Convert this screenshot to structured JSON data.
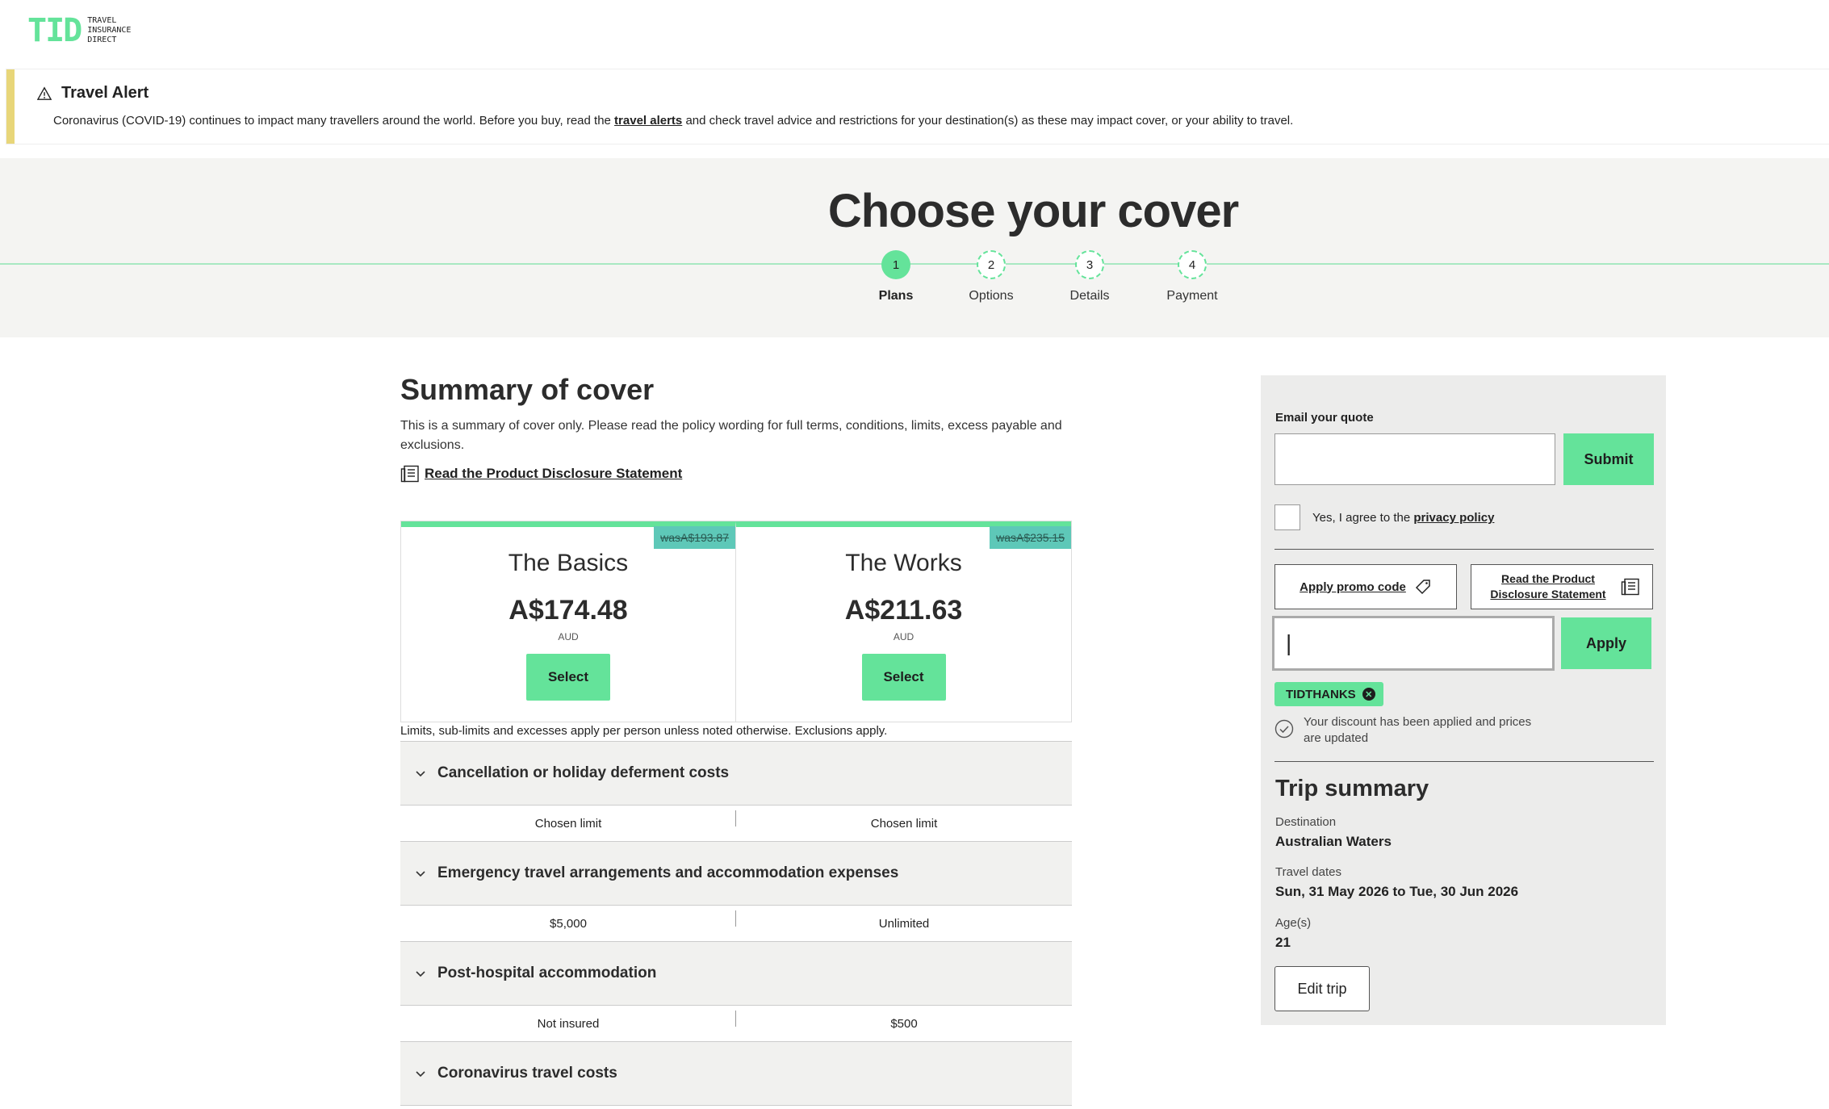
{
  "brand": {
    "logo_mark": "TID",
    "logo_text_lines": [
      "TRAVEL",
      "INSURANCE",
      "DIRECT"
    ],
    "accent_color": "#64e39a"
  },
  "alert": {
    "icon": "warning-triangle-icon",
    "title": "Travel Alert",
    "text_before": "Coronavirus (COVID-19) continues to impact many travellers around the world. Before you buy, read the ",
    "link": "travel alerts",
    "text_after": "  and check travel advice and restrictions for your destination(s) as these may impact cover, or your ability to travel."
  },
  "page_title": "Choose your cover",
  "steps": [
    {
      "number": "1",
      "label": "Plans",
      "active": true
    },
    {
      "number": "2",
      "label": "Options",
      "active": false
    },
    {
      "number": "3",
      "label": "Details",
      "active": false
    },
    {
      "number": "4",
      "label": "Payment",
      "active": false
    }
  ],
  "summary": {
    "title": "Summary of cover",
    "description": "This is a summary of cover only. Please read the policy wording for full terms, conditions, limits, excess payable and exclusions.",
    "pds_link": "Read the Product Disclosure Statement"
  },
  "plans": [
    {
      "name": "The Basics",
      "was": "wasA$193.87",
      "price": "A$174.48",
      "currency": "AUD",
      "button": "Select"
    },
    {
      "name": "The Works",
      "was": "wasA$235.15",
      "price": "A$211.63",
      "currency": "AUD",
      "button": "Select"
    }
  ],
  "limits_note": "Limits, sub-limits and excesses apply per person unless noted otherwise. Exclusions apply.",
  "benefits": [
    {
      "title": "Cancellation or holiday deferment costs",
      "basics": "Chosen limit",
      "works": "Chosen limit"
    },
    {
      "title": "Emergency travel arrangements and accommodation expenses",
      "basics": "$5,000",
      "works": "Unlimited"
    },
    {
      "title": "Post-hospital accommodation",
      "basics": "Not insured",
      "works": "$500"
    },
    {
      "title": "Coronavirus travel costs"
    }
  ],
  "sidebar": {
    "email_label": "Email your quote",
    "email_value": "",
    "submit": "Submit",
    "consent_text": "Yes, I agree to the ",
    "consent_link": "privacy policy",
    "promo_button": "Apply promo code",
    "pds_button": "Read the Product Disclosure Statement",
    "promo_value": "",
    "apply": "Apply",
    "applied_code": "TIDTHANKS",
    "discount_message": "Your discount has been applied and prices are updated"
  },
  "trip": {
    "title": "Trip summary",
    "destination_label": "Destination",
    "destination": "Australian Waters",
    "dates_label": "Travel dates",
    "dates": "Sun, 31 May 2026 to Tue, 30 Jun 2026",
    "ages_label": "Age(s)",
    "ages": "21",
    "edit_button": "Edit trip"
  }
}
